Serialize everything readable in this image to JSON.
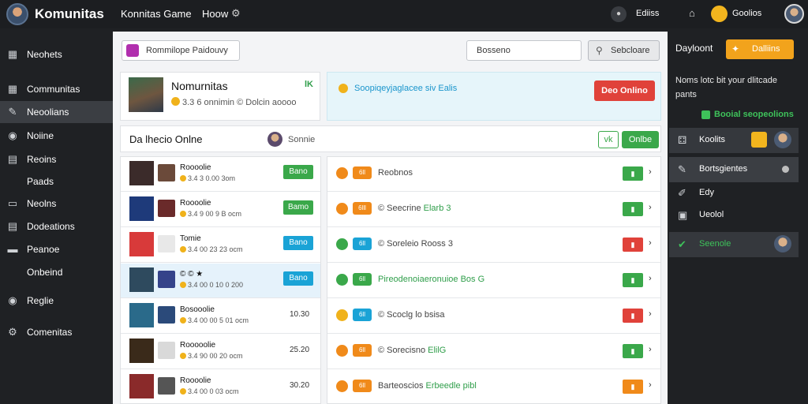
{
  "app": {
    "title": "Komunitas",
    "nav": [
      "Konnitas Game",
      "Hoow"
    ],
    "user_labels": [
      "Ediiss",
      "Goolios"
    ]
  },
  "left_nav": [
    {
      "label": "Neohets",
      "icon": "grid-icon",
      "active": false
    },
    {
      "label": "Communitas",
      "icon": "grid-icon",
      "active": false
    },
    {
      "label": "Neoolians",
      "icon": "pin-icon",
      "active": true
    },
    {
      "label": "Noiine",
      "icon": "chat-icon",
      "active": false
    },
    {
      "label": "Reoins",
      "icon": "doc-icon",
      "active": false
    },
    {
      "label": "Paads",
      "icon": "",
      "active": false
    },
    {
      "label": "Neolns",
      "icon": "list-icon",
      "active": false
    },
    {
      "label": "Dodeations",
      "icon": "doc-icon",
      "active": false
    },
    {
      "label": "Peanoe",
      "icon": "card-icon",
      "active": false
    },
    {
      "label": "Onbeind",
      "icon": "",
      "active": false
    },
    {
      "label": "Reglie",
      "icon": "chat-icon",
      "active": false
    },
    {
      "label": "Comenitas",
      "icon": "gear-icon",
      "active": false
    }
  ],
  "search": {
    "left": "Rommilope Paidouvy",
    "right": "Bosseno",
    "button": "Sebcloare"
  },
  "profile": {
    "name": "Nomurnitas",
    "badge": "lK",
    "meta": "3.3 6 onnimin © Dolcin aoooo"
  },
  "notification": {
    "text": "Soopiqeyjaglacee siv Ealis",
    "button": "Deo Onlino"
  },
  "online": {
    "title": "Da lhecio Onlne",
    "user": "Sonnie",
    "check_label": "vk",
    "button": "Onlbe"
  },
  "left_rows": [
    {
      "name": "Roooolie",
      "meta": "3.4 3 0.00 3om",
      "btn": "Bano",
      "btn_color": "#3aa84a",
      "num": "",
      "game_color": "#3b2b2a",
      "small_color": "#6b4a3a"
    },
    {
      "name": "Roooolie",
      "meta": "3.4 9 00 9 B ocm",
      "btn": "Bamo",
      "btn_color": "#3aa84a",
      "num": "",
      "game_color": "#1e3a7a",
      "small_color": "#6a2a2a"
    },
    {
      "name": "Tomie",
      "meta": "3.4 00 23 23 ocm",
      "btn": "Bano",
      "btn_color": "#1aa3d6",
      "num": "",
      "game_color": "#d83a3a",
      "small_color": "#e8e8e8"
    },
    {
      "name": "© © ★",
      "meta": "3.4 00 0 10 0 200",
      "btn": "Bano",
      "btn_color": "#1aa3d6",
      "num": "",
      "game_color": "#2e4a5e",
      "small_color": "#35438a",
      "selected": true
    },
    {
      "name": "Bosooolie",
      "meta": "3.4 00 00 5 01 ocm",
      "btn": "",
      "btn_color": "",
      "num": "10.30",
      "game_color": "#2a6a8a",
      "small_color": "#2b4a7a"
    },
    {
      "name": "Rooooolie",
      "meta": "3.4 90 00 20 ocm",
      "btn": "",
      "btn_color": "",
      "num": "25.20",
      "game_color": "#3a2a1a",
      "small_color": "#d9d9d9"
    },
    {
      "name": "Roooolie",
      "meta": "3.4 00 0 03 ocm",
      "btn": "",
      "btn_color": "",
      "num": "30.20",
      "game_color": "#8a2a2a",
      "small_color": "#555555"
    }
  ],
  "right_rows": [
    {
      "ic_color": "#f08a1a",
      "pill": "6ll",
      "pill_color": "#f08a1a",
      "text": "Reobnos",
      "hl": "",
      "act_color": "#3aa84a"
    },
    {
      "ic_color": "#f08a1a",
      "pill": "6lll",
      "pill_color": "#f08a1a",
      "text": "© Seecrine",
      "hl": "Elarb 3",
      "act_color": "#3aa84a"
    },
    {
      "ic_color": "#3aa84a",
      "pill": "6ll",
      "pill_color": "#1aa3d6",
      "text": "© Soreleio",
      "hl": "",
      "text2": "Rooss 3",
      "act_color": "#e0423a"
    },
    {
      "ic_color": "#3aa84a",
      "pill": "6ll",
      "pill_color": "#3aa84a",
      "text": "",
      "hl": "Pireodenoiaeronuioe Bos G",
      "act_color": "#3aa84a"
    },
    {
      "ic_color": "#f0b21b",
      "pill": "6ll",
      "pill_color": "#1aa3d6",
      "text": "© Scoclg",
      "hl": "",
      "text2": "lo bsisa",
      "act_color": "#e0423a"
    },
    {
      "ic_color": "#f08a1a",
      "pill": "6ll",
      "pill_color": "#f08a1a",
      "text": "© Sorecisno",
      "hl": "ElilG",
      "act_color": "#3aa84a"
    },
    {
      "ic_color": "#f08a1a",
      "pill": "6ll",
      "pill_color": "#f08a1a",
      "text": "Barteoscios",
      "hl": "Erbeedle pibl",
      "act_color": "#f08a1a"
    }
  ],
  "right_sidebar": {
    "title": "Dayloont",
    "button": "Dalliins",
    "desc": "Noms lotc bit your dlitcade pants",
    "link": "Booial seopeolions",
    "items": [
      {
        "label": "Koolits",
        "icon": "grid-icon",
        "style": "hl"
      },
      {
        "label": "Bortsgientes",
        "icon": "wrench-icon",
        "style": "hl2"
      },
      {
        "label": "Edy",
        "icon": "pen-icon",
        "style": ""
      },
      {
        "label": "Ueolol",
        "icon": "doc-icon",
        "style": ""
      },
      {
        "label": "Seenole",
        "icon": "check-icon",
        "style": "hl"
      }
    ]
  }
}
